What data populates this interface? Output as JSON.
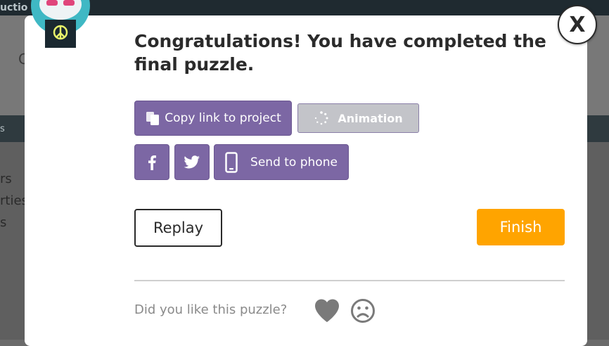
{
  "background": {
    "topbar_text": "uctio",
    "header_letter": "C",
    "nav_text": "s",
    "list_items": [
      "rs",
      "rties",
      "s"
    ]
  },
  "dialog": {
    "title": "Congratulations! You have completed the final puzzle.",
    "close_label": "X",
    "share": {
      "copy_link_label": "Copy link to project",
      "animation_label": "Animation",
      "send_to_phone_label": "Send to phone"
    },
    "replay_label": "Replay",
    "finish_label": "Finish",
    "feedback_prompt": "Did you like this puzzle?"
  },
  "icons": {
    "copy": "copy-icon",
    "spinner": "spinner-icon",
    "facebook": "facebook-icon",
    "twitter": "twitter-icon",
    "phone": "phone-icon",
    "heart": "heart-icon",
    "sad_face": "sad-face-icon"
  },
  "colors": {
    "share_purple": "#7c67a4",
    "finish_orange": "#ffa400",
    "disabled_gray": "#c3c4c9"
  }
}
